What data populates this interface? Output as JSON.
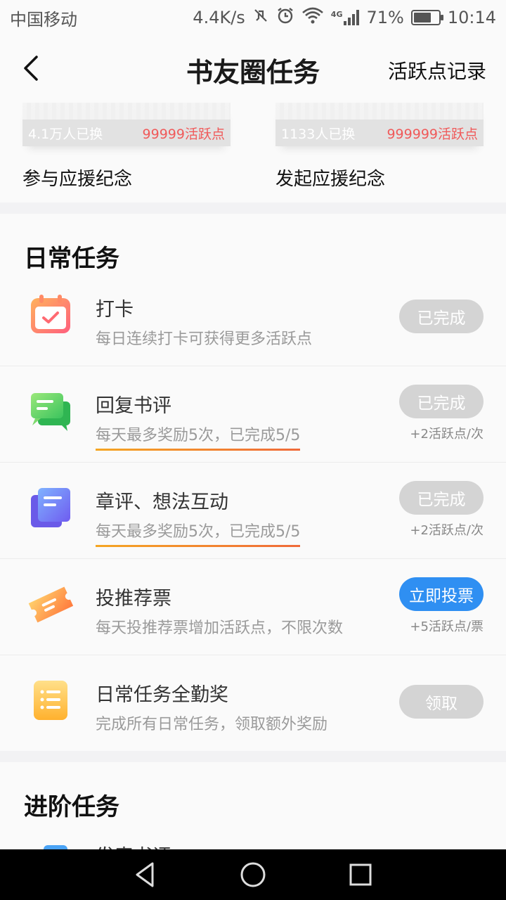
{
  "status_bar": {
    "carrier": "中国移动",
    "speed": "4.4K/s",
    "network": "4G",
    "battery_text": "71%",
    "battery_level": 71,
    "time": "10:14"
  },
  "header": {
    "title": "书友圈任务",
    "right_link": "活跃点记录"
  },
  "souvenirs": [
    {
      "count": "4.1万人已换",
      "price": "99999活跃点",
      "label": "参与应援纪念"
    },
    {
      "count": "1133人已换",
      "price": "999999活跃点",
      "label": "发起应援纪念"
    }
  ],
  "daily": {
    "title": "日常任务",
    "tasks": [
      {
        "icon": "calendar-check-icon",
        "title": "打卡",
        "desc": "每日连续打卡可获得更多活跃点",
        "button": "已完成",
        "bonus": ""
      },
      {
        "icon": "chat-bubble-icon",
        "title": "回复书评",
        "desc": "每天最多奖励5次，已完成5/5",
        "button": "已完成",
        "bonus": "+2活跃点/次"
      },
      {
        "icon": "notes-icon",
        "title": "章评、想法互动",
        "desc": "每天最多奖励5次，已完成5/5",
        "button": "已完成",
        "bonus": "+2活跃点/次"
      },
      {
        "icon": "ticket-icon",
        "title": "投推荐票",
        "desc": "每天投推荐票增加活跃点，不限次数",
        "button": "立即投票",
        "bonus": "+5活跃点/票"
      },
      {
        "icon": "list-icon",
        "title": "日常任务全勤奖",
        "desc": "完成所有日常任务，领取额外奖励",
        "button": "领取",
        "bonus": ""
      }
    ]
  },
  "advanced": {
    "title": "进阶任务",
    "first_task_partial": "发表书评"
  },
  "colors": {
    "accent_blue": "#2f8ff2",
    "done_gray": "#d4d4d4",
    "price_red": "#f05a5a"
  }
}
